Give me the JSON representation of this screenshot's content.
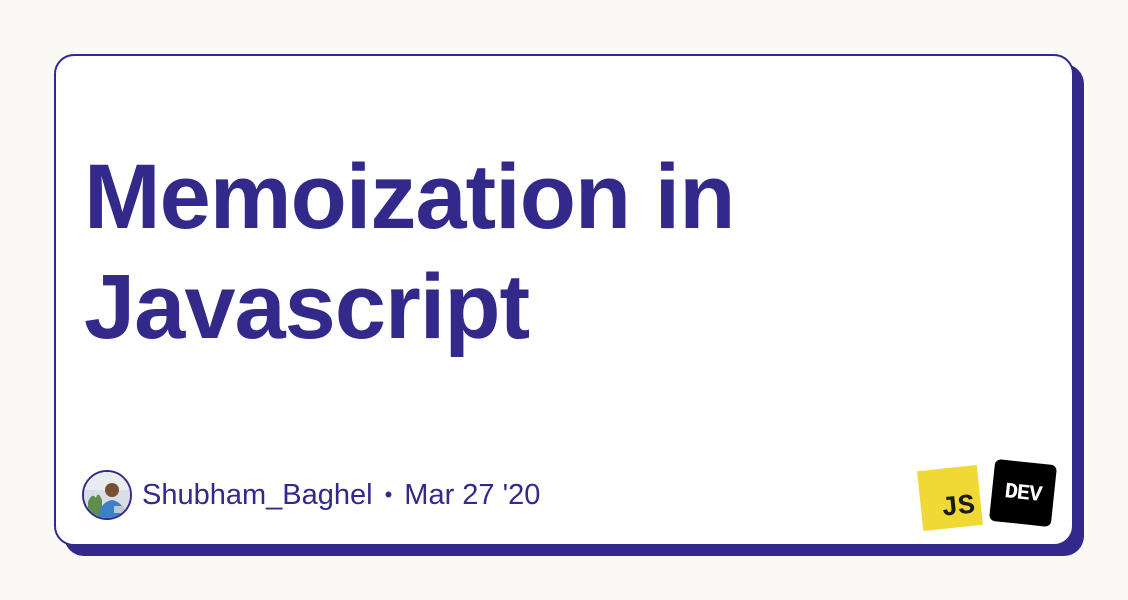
{
  "article": {
    "title": "Memoization in Javascript"
  },
  "author": {
    "name": "Shubham_Baghel",
    "avatar_icon": "author-avatar-photo"
  },
  "meta": {
    "separator": "•",
    "date": "Mar 27 '20"
  },
  "tags": {
    "js_label": "JS"
  },
  "brand": {
    "dev_label": "DEV"
  },
  "colors": {
    "accent": "#33298a",
    "background": "#fbf9f6",
    "card": "#ffffff",
    "js_yellow": "#f0d935",
    "dev_black": "#000000"
  }
}
